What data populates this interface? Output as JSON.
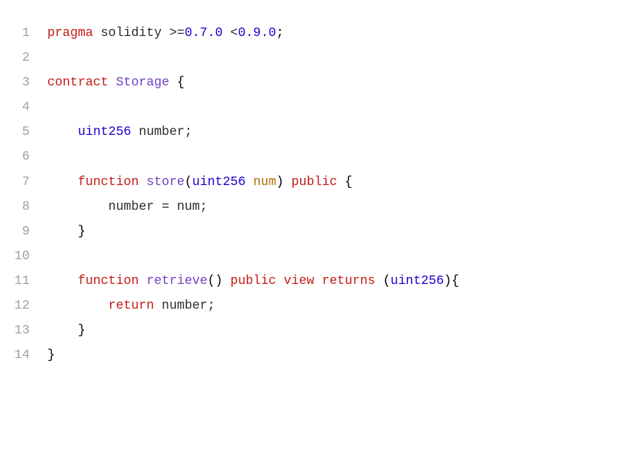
{
  "chart_data": {
    "type": "table",
    "title": "Solidity Code Snippet",
    "language": "solidity",
    "line_numbers": [
      "1",
      "2",
      "3",
      "4",
      "5",
      "6",
      "7",
      "8",
      "9",
      "10",
      "11",
      "12",
      "13",
      "14"
    ],
    "lines": [
      {
        "tokens": [
          {
            "t": "pragma",
            "c": "kw-red"
          },
          {
            "t": " ",
            "c": "text"
          },
          {
            "t": "solidity",
            "c": "text"
          },
          {
            "t": " >=",
            "c": "text"
          },
          {
            "t": "0.7.0",
            "c": "kw-blue"
          },
          {
            "t": " <",
            "c": "text"
          },
          {
            "t": "0.9.0",
            "c": "kw-blue"
          },
          {
            "t": ";",
            "c": "punct"
          }
        ]
      },
      {
        "tokens": [
          {
            "t": "",
            "c": "text"
          }
        ]
      },
      {
        "tokens": [
          {
            "t": "contract",
            "c": "kw-red"
          },
          {
            "t": " ",
            "c": "text"
          },
          {
            "t": "Storage",
            "c": "ident-purple"
          },
          {
            "t": " {",
            "c": "punct"
          }
        ]
      },
      {
        "tokens": [
          {
            "t": "",
            "c": "text"
          }
        ]
      },
      {
        "tokens": [
          {
            "t": "    ",
            "c": "text"
          },
          {
            "t": "uint256",
            "c": "kw-type"
          },
          {
            "t": " number;",
            "c": "text"
          }
        ]
      },
      {
        "tokens": [
          {
            "t": "",
            "c": "text"
          }
        ]
      },
      {
        "tokens": [
          {
            "t": "    ",
            "c": "text"
          },
          {
            "t": "function",
            "c": "kw-red"
          },
          {
            "t": " ",
            "c": "text"
          },
          {
            "t": "store",
            "c": "ident-purple"
          },
          {
            "t": "(",
            "c": "punct"
          },
          {
            "t": "uint256",
            "c": "kw-type"
          },
          {
            "t": " ",
            "c": "text"
          },
          {
            "t": "num",
            "c": "param"
          },
          {
            "t": ") ",
            "c": "punct"
          },
          {
            "t": "public",
            "c": "kw-red"
          },
          {
            "t": " {",
            "c": "punct"
          }
        ]
      },
      {
        "tokens": [
          {
            "t": "        number = num;",
            "c": "text"
          }
        ]
      },
      {
        "tokens": [
          {
            "t": "    }",
            "c": "punct"
          }
        ]
      },
      {
        "tokens": [
          {
            "t": "",
            "c": "text"
          }
        ]
      },
      {
        "tokens": [
          {
            "t": "    ",
            "c": "text"
          },
          {
            "t": "function",
            "c": "kw-red"
          },
          {
            "t": " ",
            "c": "text"
          },
          {
            "t": "retrieve",
            "c": "ident-purple"
          },
          {
            "t": "() ",
            "c": "punct"
          },
          {
            "t": "public",
            "c": "kw-red"
          },
          {
            "t": " ",
            "c": "text"
          },
          {
            "t": "view",
            "c": "kw-red"
          },
          {
            "t": " ",
            "c": "text"
          },
          {
            "t": "returns",
            "c": "kw-red"
          },
          {
            "t": " (",
            "c": "punct"
          },
          {
            "t": "uint256",
            "c": "kw-type"
          },
          {
            "t": "){",
            "c": "punct"
          }
        ]
      },
      {
        "tokens": [
          {
            "t": "        ",
            "c": "text"
          },
          {
            "t": "return",
            "c": "kw-red"
          },
          {
            "t": " number;",
            "c": "text"
          }
        ]
      },
      {
        "tokens": [
          {
            "t": "    }",
            "c": "punct"
          }
        ]
      },
      {
        "tokens": [
          {
            "t": "}",
            "c": "punct"
          }
        ]
      }
    ]
  }
}
